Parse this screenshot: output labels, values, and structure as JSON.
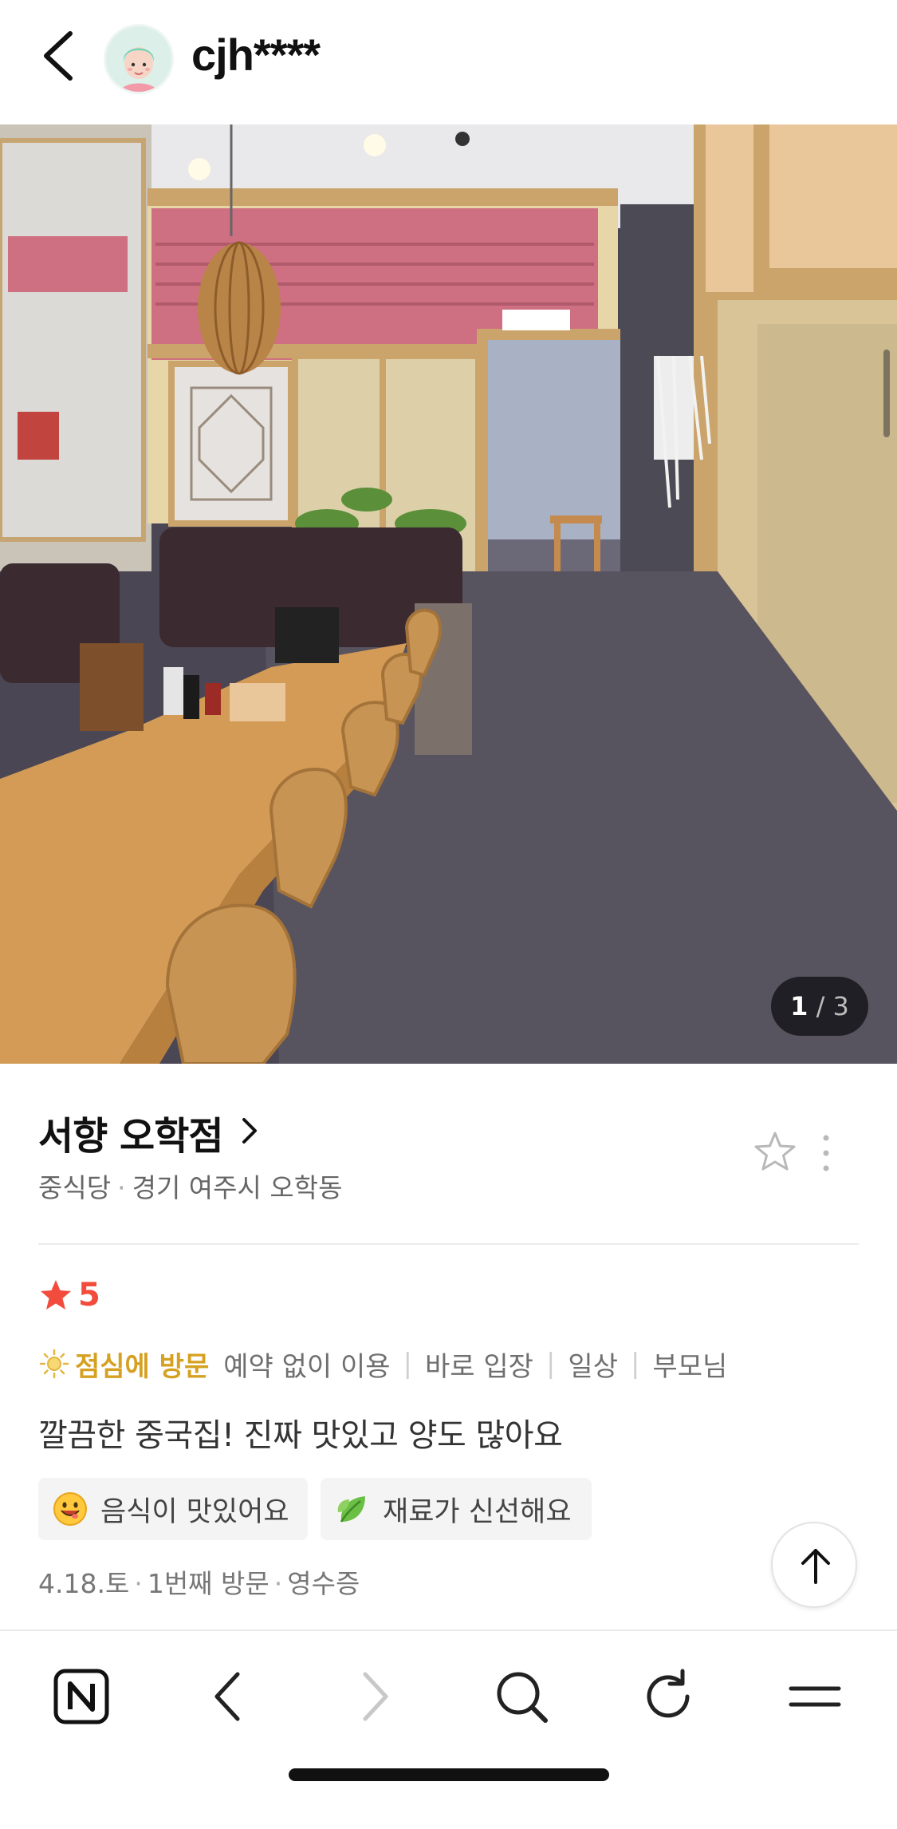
{
  "header": {
    "username": "cjh****"
  },
  "photo": {
    "current": "1",
    "separator": "/",
    "total": "3"
  },
  "store": {
    "name": "서향 오학점",
    "category": "중식당",
    "location": "경기 여주시 오학동"
  },
  "review": {
    "rating": "5",
    "visit_time": "점심에 방문",
    "tags": [
      "예약 없이 이용",
      "바로 입장",
      "일상",
      "부모님"
    ],
    "text": "깔끔한 중국집! 진짜 맛있고 양도 많아요",
    "keywords": [
      {
        "icon": "smiling-face-icon",
        "label": "음식이 맛있어요"
      },
      {
        "icon": "leaf-icon",
        "label": "재료가 신선해요"
      }
    ],
    "date": "4.18.토",
    "visit_count": "1번째 방문",
    "verification": "영수증"
  },
  "colors": {
    "rating": "#f24c3d",
    "visit_time": "#d6a021",
    "muted_text": "#777777"
  },
  "bottom_nav": [
    "naver-home-icon",
    "back-arrow-icon",
    "forward-arrow-icon",
    "search-icon",
    "refresh-icon",
    "menu-icon"
  ]
}
